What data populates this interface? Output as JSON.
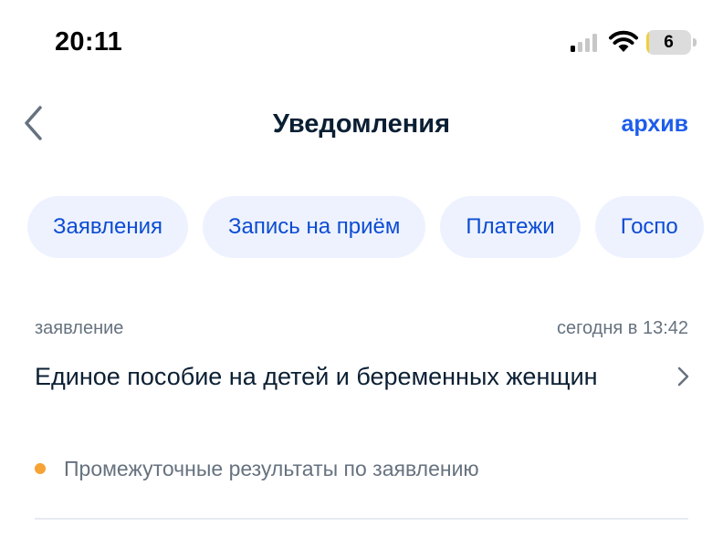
{
  "status_bar": {
    "time": "20:11",
    "battery_level": "6",
    "battery_fraction": 0.06
  },
  "nav": {
    "title": "Уведомления",
    "archive_label": "архив"
  },
  "chips": [
    {
      "label": "Заявления"
    },
    {
      "label": "Запись на приём"
    },
    {
      "label": "Платежи"
    },
    {
      "label": "Госпо"
    }
  ],
  "notification": {
    "type": "заявление",
    "time": "сегодня в 13:42",
    "title": "Единое пособие на детей и беременных женщин",
    "status": "Промежуточные результаты по заявлению"
  },
  "colors": {
    "accent": "#1d5deb",
    "chip_background": "#edf2fe",
    "status_dot": "#f7a234",
    "battery_fill": "#f2cf3a"
  },
  "icons": {
    "back": "chevron-left-icon",
    "item_arrow": "chevron-right-icon",
    "signal": "cellular-signal-icon",
    "wifi": "wifi-icon",
    "battery": "battery-icon"
  }
}
